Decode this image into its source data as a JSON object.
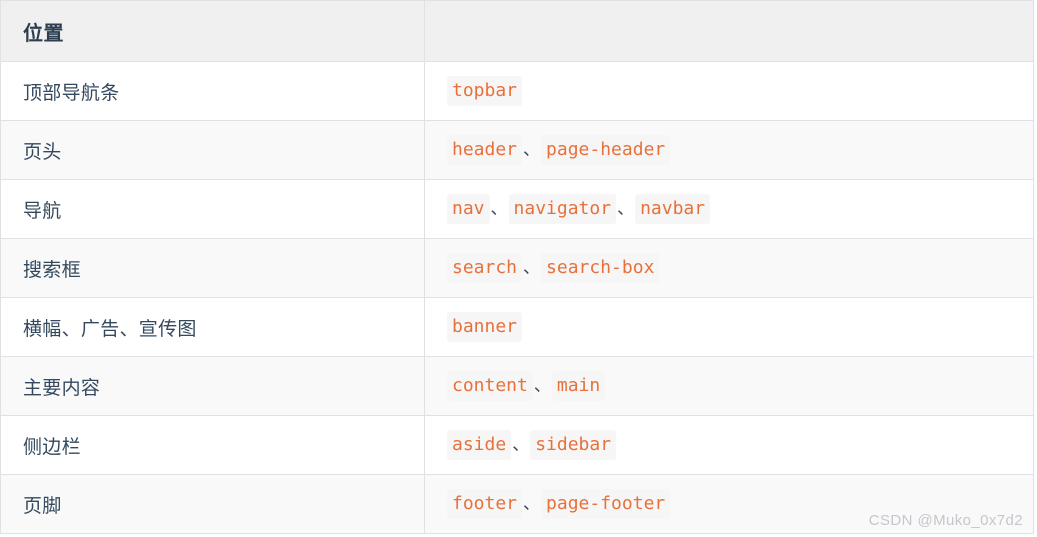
{
  "table": {
    "headers": [
      {
        "label": "位置"
      },
      {
        "label": ""
      }
    ],
    "rows": [
      {
        "location": "顶部导航条",
        "names": [
          "topbar"
        ]
      },
      {
        "location": "页头",
        "names": [
          "header",
          "page-header"
        ]
      },
      {
        "location": "导航",
        "names": [
          "nav",
          "navigator",
          "navbar"
        ]
      },
      {
        "location": "搜索框",
        "names": [
          "search",
          "search-box"
        ]
      },
      {
        "location": "横幅、广告、宣传图",
        "names": [
          "banner"
        ]
      },
      {
        "location": "主要内容",
        "names": [
          "content",
          "main"
        ]
      },
      {
        "location": "侧边栏",
        "names": [
          "aside",
          "sidebar"
        ]
      },
      {
        "location": "页脚",
        "names": [
          "footer",
          "page-footer"
        ]
      }
    ],
    "separator": "、"
  },
  "watermark": {
    "text": "CSDN @Muko_0x7d2"
  },
  "colors": {
    "code_text": "#e8703a",
    "code_background": "#f6f6f7",
    "header_background": "#f0f0f1",
    "header_text": "#2c3e50",
    "body_text": "#34495e",
    "border": "#dfe2e5",
    "stripe_background": "#f9f9fa",
    "watermark_text": "#c4c7cb"
  }
}
